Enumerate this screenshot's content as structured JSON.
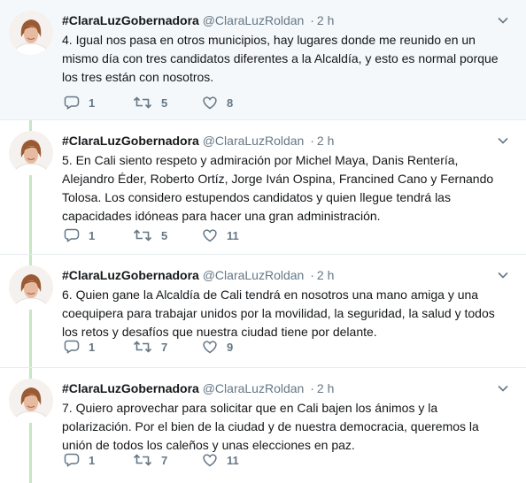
{
  "tweets": [
    {
      "name": "#ClaraLuzGobernadora",
      "handle": "@ClaraLuzRoldan",
      "separator": "·",
      "time": "2 h",
      "text": "4. Igual nos pasa en otros municipios, hay lugares donde me reunido en un mismo día con tres candidatos diferentes a la Alcaldía, y esto es normal porque los tres están con nosotros.",
      "replies": "1",
      "retweets": "5",
      "likes": "8"
    },
    {
      "name": "#ClaraLuzGobernadora",
      "handle": "@ClaraLuzRoldan",
      "separator": "·",
      "time": "2 h",
      "text": "5. En Cali siento respeto y admiración por Michel Maya, Danis Rentería, Alejandro Éder, Roberto Ortíz, Jorge Iván Ospina, Francined Cano y Fernando Tolosa. Los considero estupendos candidatos y quien llegue tendrá las capacidades idóneas para hacer una gran administración.",
      "replies": "1",
      "retweets": "5",
      "likes": "11"
    },
    {
      "name": "#ClaraLuzGobernadora",
      "handle": "@ClaraLuzRoldan",
      "separator": "·",
      "time": "2 h",
      "text": "6. Quien gane la Alcaldía de Cali tendrá en nosotros una mano amiga y una coequipera para trabajar unidos por la movilidad, la seguridad, la salud y todos los retos y desafíos que nuestra ciudad tiene por delante.",
      "replies": "1",
      "retweets": "7",
      "likes": "9"
    },
    {
      "name": "#ClaraLuzGobernadora",
      "handle": "@ClaraLuzRoldan",
      "separator": "·",
      "time": "2 h",
      "text": "7. Quiero aprovechar para solicitar que en Cali bajen los ánimos y la polarización. Por el bien de la ciudad y de nuestra democracia, queremos la unión de todos los caleños y unas elecciones en paz.",
      "replies": "1",
      "retweets": "7",
      "likes": "11"
    }
  ],
  "colors": {
    "thread_line": "#c7e6c2",
    "muted": "#657786",
    "text": "#14171a",
    "highlight_bg": "#f5f8fa"
  },
  "icons": {
    "reply": "reply-icon",
    "retweet": "retweet-icon",
    "like": "heart-icon",
    "menu": "chevron-down-icon"
  }
}
